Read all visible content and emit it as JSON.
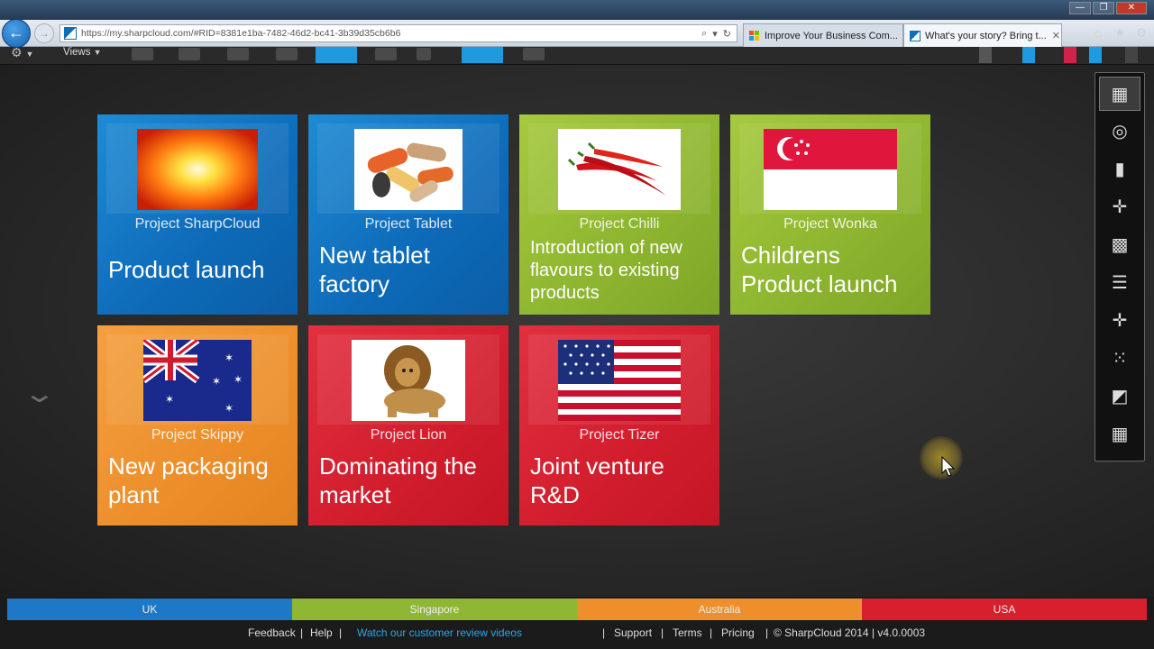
{
  "browser": {
    "url": "https://my.sharpcloud.com/#RID=8381e1ba-7482-46d2-bc41-3b39d35cb6b6",
    "tabs": [
      {
        "title": "Improve Your Business Com...",
        "active": false
      },
      {
        "title": "What's your story? Bring t...",
        "active": true
      }
    ],
    "window_controls": [
      "—",
      "❐",
      "✕"
    ]
  },
  "toolbar": {
    "views_label": "Views",
    "highlight_color": "#1e9be0"
  },
  "tiles": [
    {
      "project": "Project SharpCloud",
      "title": "Product launch",
      "color": "blue",
      "image": "sunburst-image"
    },
    {
      "project": "Project Tablet",
      "title": "New tablet factory",
      "color": "blue",
      "image": "pills-image"
    },
    {
      "project": "Project Chilli",
      "title": "Introduction of new flavours to existing products",
      "color": "green",
      "image": "chilli-image"
    },
    {
      "project": "Project Wonka",
      "title": "Childrens Product launch",
      "color": "green",
      "image": "singapore-flag-image"
    },
    {
      "project": "Project Skippy",
      "title": "New packaging plant",
      "color": "orange",
      "image": "australia-flag-image"
    },
    {
      "project": "Project Lion",
      "title": "Dominating the market",
      "color": "red",
      "image": "lion-image"
    },
    {
      "project": "Project Tizer",
      "title": "Joint venture R&D",
      "color": "red",
      "image": "usa-flag-image"
    }
  ],
  "colors": {
    "blue": "#1477c6",
    "green": "#97bf35",
    "orange": "#ef9430",
    "red": "#d8202f"
  },
  "view_toolbar": [
    {
      "icon": "grid-view-icon",
      "active": true
    },
    {
      "icon": "circle-view-icon",
      "active": false
    },
    {
      "icon": "bar-chart-view-icon",
      "active": false
    },
    {
      "icon": "crosshair-view-icon",
      "active": false
    },
    {
      "icon": "matrix-view-icon",
      "active": false
    },
    {
      "icon": "timeline-view-icon",
      "active": false
    },
    {
      "icon": "quadrant-view-icon",
      "active": false
    },
    {
      "icon": "scatter-view-icon",
      "active": false
    },
    {
      "icon": "cube-view-icon",
      "active": false
    },
    {
      "icon": "tiles-view-icon",
      "active": false
    }
  ],
  "regions": [
    {
      "label": "UK",
      "color": "#1e78c8"
    },
    {
      "label": "Singapore",
      "color": "#8fb733"
    },
    {
      "label": "Australia",
      "color": "#ee8f2c"
    },
    {
      "label": "USA",
      "color": "#d71f2e"
    }
  ],
  "footer": {
    "feedback": "Feedback",
    "help": "Help",
    "videos": "Watch our customer review videos",
    "support": "Support",
    "terms": "Terms",
    "pricing": "Pricing",
    "copyright": "© SharpCloud 2014 | v4.0.0003"
  }
}
